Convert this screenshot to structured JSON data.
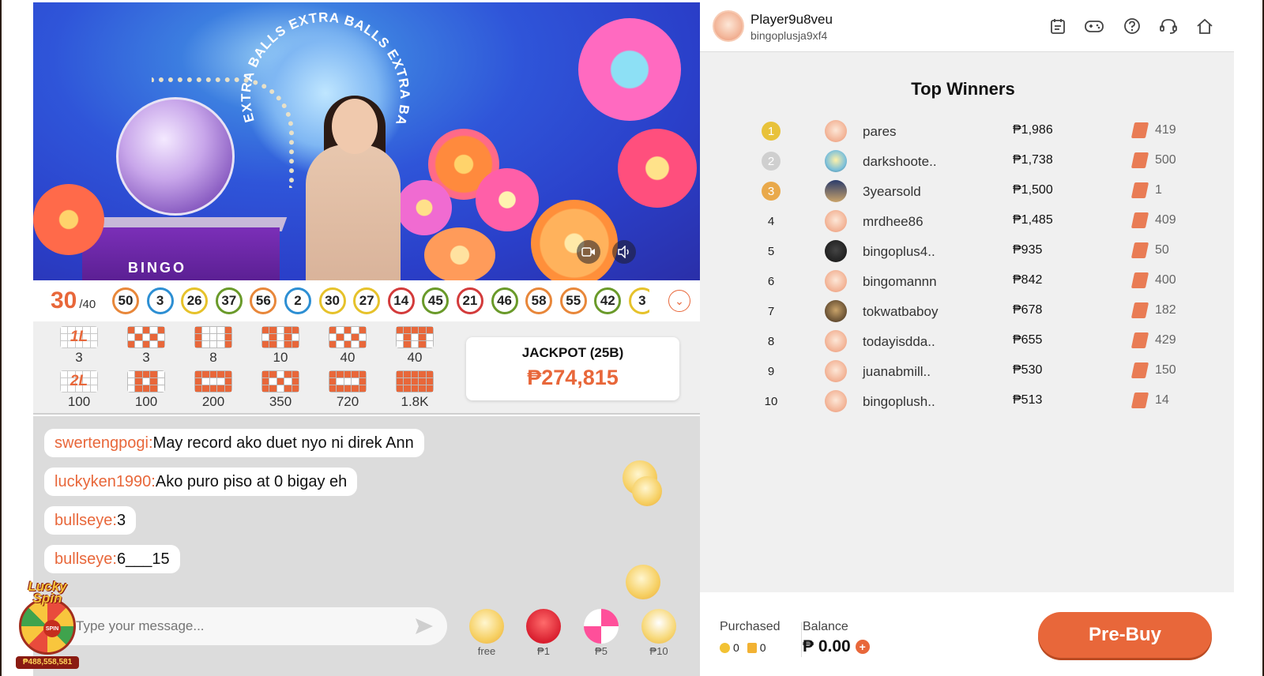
{
  "video": {
    "arc_text": "EXTRA BALLS EXTRA BALLS EXTRA BALLS",
    "machine_label": "BINGO"
  },
  "ball_strip": {
    "drawn_count": "30",
    "total": "/40",
    "balls": [
      {
        "n": "50",
        "color": "#e8873a"
      },
      {
        "n": "3",
        "color": "#2d8fd3"
      },
      {
        "n": "26",
        "color": "#e6c22b"
      },
      {
        "n": "37",
        "color": "#6a9a2a"
      },
      {
        "n": "56",
        "color": "#e8873a"
      },
      {
        "n": "2",
        "color": "#2d8fd3"
      },
      {
        "n": "30",
        "color": "#e6c22b"
      },
      {
        "n": "27",
        "color": "#e6c22b"
      },
      {
        "n": "14",
        "color": "#d33b3b"
      },
      {
        "n": "45",
        "color": "#6a9a2a"
      },
      {
        "n": "21",
        "color": "#d33b3b"
      },
      {
        "n": "46",
        "color": "#6a9a2a"
      },
      {
        "n": "58",
        "color": "#e8873a"
      },
      {
        "n": "55",
        "color": "#e8873a"
      },
      {
        "n": "42",
        "color": "#6a9a2a"
      },
      {
        "n": "3",
        "color": "#e6c22b"
      }
    ]
  },
  "patterns": {
    "row1": [
      {
        "label": "1L",
        "value": "3"
      },
      {
        "value": "3"
      },
      {
        "value": "8"
      },
      {
        "value": "10"
      },
      {
        "value": "40"
      },
      {
        "value": "40"
      }
    ],
    "row2": [
      {
        "label": "2L",
        "value": "100"
      },
      {
        "value": "100"
      },
      {
        "value": "200"
      },
      {
        "value": "350"
      },
      {
        "value": "720"
      },
      {
        "value": "1.8K"
      }
    ]
  },
  "jackpot": {
    "title": "JACKPOT (25B)",
    "amount": "₱274,815"
  },
  "chat": {
    "messages": [
      {
        "user": "swertengpogi:",
        "text": "May record ako duet nyo ni direk Ann"
      },
      {
        "user": "luckyken1990:",
        "text": "Ako puro piso at 0 bigay eh"
      },
      {
        "user": "bullseye:",
        "text": "3"
      },
      {
        "user": "bullseye:",
        "text": "6___15"
      }
    ],
    "input_placeholder": "Type your message...",
    "gifts": [
      {
        "price": "free"
      },
      {
        "price": "₱1"
      },
      {
        "price": "₱5"
      },
      {
        "price": "₱10"
      }
    ]
  },
  "lucky_spin": {
    "title": "Lucky Spin",
    "hub": "SPIN",
    "amount": "₱488,558,581"
  },
  "profile": {
    "player_name": "Player9u8veu",
    "username": "bingoplusja9xf4"
  },
  "header_icons": [
    "calendar-icon",
    "gamepad-icon",
    "help-icon",
    "headset-icon",
    "home-icon"
  ],
  "winners": {
    "title": "Top Winners",
    "rows": [
      {
        "rank": "1",
        "name": "pares",
        "prize": "₱1,986",
        "cards": "419"
      },
      {
        "rank": "2",
        "name": "darkshoote..",
        "prize": "₱1,738",
        "cards": "500"
      },
      {
        "rank": "3",
        "name": "3yearsold",
        "prize": "₱1,500",
        "cards": "1"
      },
      {
        "rank": "4",
        "name": "mrdhee86",
        "prize": "₱1,485",
        "cards": "409"
      },
      {
        "rank": "5",
        "name": "bingoplus4..",
        "prize": "₱935",
        "cards": "50"
      },
      {
        "rank": "6",
        "name": "bingomannn",
        "prize": "₱842",
        "cards": "400"
      },
      {
        "rank": "7",
        "name": "tokwatbaboy",
        "prize": "₱678",
        "cards": "182"
      },
      {
        "rank": "8",
        "name": "todayisdda..",
        "prize": "₱655",
        "cards": "429"
      },
      {
        "rank": "9",
        "name": "juanabmill..",
        "prize": "₱530",
        "cards": "150"
      },
      {
        "rank": "10",
        "name": "bingoplush..",
        "prize": "₱513",
        "cards": "14"
      }
    ]
  },
  "footer": {
    "purchased_label": "Purchased",
    "coins": "0",
    "tickets": "0",
    "balance_label": "Balance",
    "balance": "₱ 0.00",
    "prebuy_label": "Pre-Buy"
  },
  "colors": {
    "accent": "#e8673a",
    "gold": "#e8c23a"
  }
}
